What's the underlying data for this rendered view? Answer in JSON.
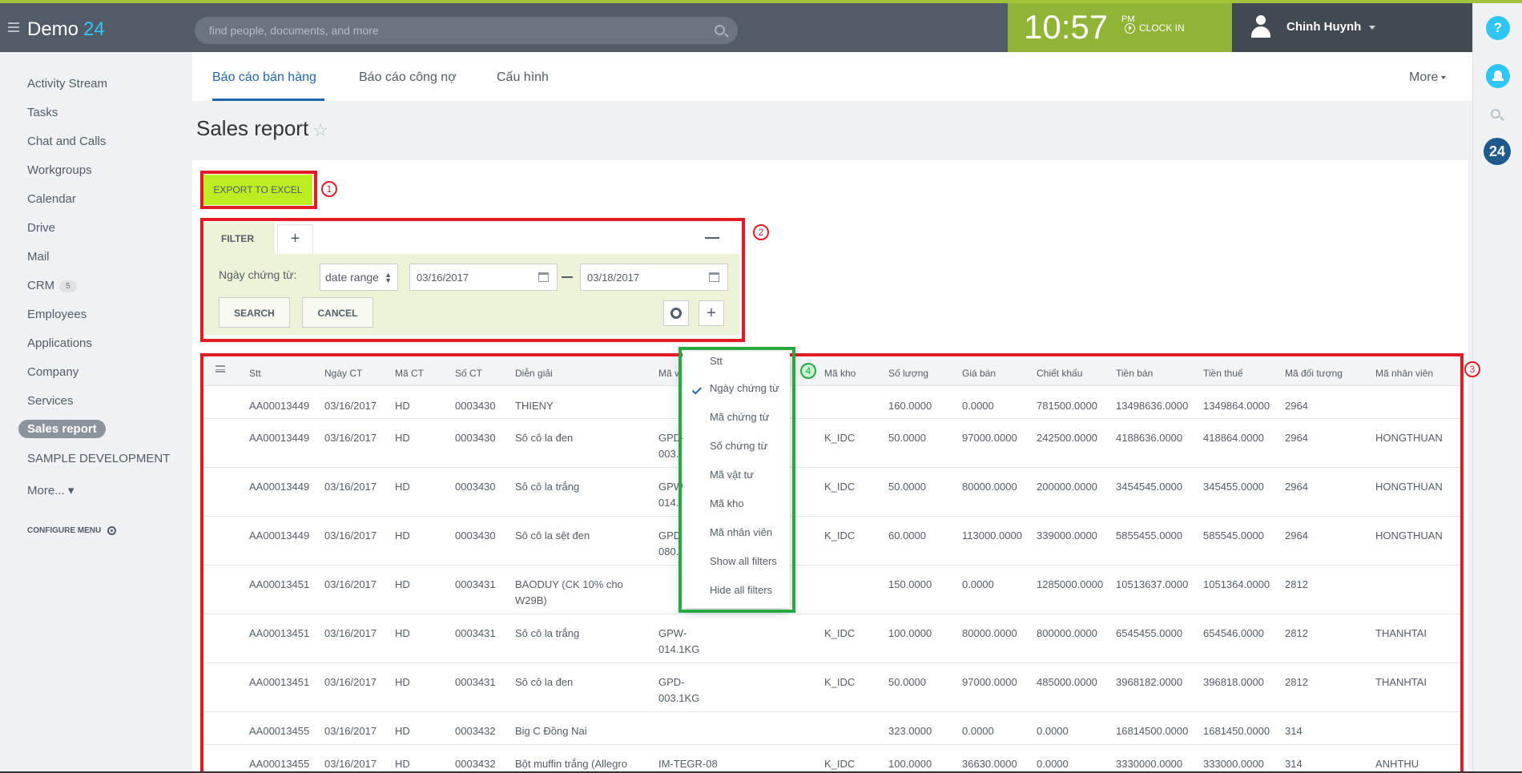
{
  "app": {
    "name": "Demo",
    "number": "24"
  },
  "search": {
    "placeholder": "find people, documents, and more"
  },
  "clock": {
    "time": "10:57",
    "ampm": "PM",
    "clockin_label": "CLOCK IN"
  },
  "user": {
    "name": "Chinh Huynh"
  },
  "rail": {
    "help": "?",
    "badge": "24"
  },
  "sidebar": {
    "items": [
      {
        "label": "Activity Stream"
      },
      {
        "label": "Tasks"
      },
      {
        "label": "Chat and Calls"
      },
      {
        "label": "Workgroups"
      },
      {
        "label": "Calendar"
      },
      {
        "label": "Drive"
      },
      {
        "label": "Mail"
      },
      {
        "label": "CRM",
        "badge": "5"
      },
      {
        "label": "Employees"
      },
      {
        "label": "Applications"
      },
      {
        "label": "Company"
      },
      {
        "label": "Services"
      },
      {
        "label": "Sales report"
      },
      {
        "label": "SAMPLE DEVELOPMENT"
      },
      {
        "label": "More... ▾"
      }
    ],
    "configure_label": "CONFIGURE MENU"
  },
  "tabs": {
    "items": [
      "Báo cáo bán hàng",
      "Báo cáo công nợ",
      "Cấu hình"
    ],
    "more": "More"
  },
  "page": {
    "title": "Sales report",
    "export_label": "EXPORT TO EXCEL"
  },
  "annotations": {
    "m1": "1",
    "m2": "2",
    "m3": "3",
    "m4": "4"
  },
  "filter": {
    "tab_label": "FILTER",
    "add_label": "+",
    "field_label": "Ngày chứng từ:",
    "range_type": "date range",
    "date_from": "03/16/2017",
    "date_to": "03/18/2017",
    "search_label": "SEARCH",
    "cancel_label": "CANCEL",
    "plus_label": "+"
  },
  "grid": {
    "columns": [
      "Stt",
      "Ngày CT",
      "Mã CT",
      "Số CT",
      "Diễn giải",
      "Mã v",
      "Mã kho",
      "Số lượng",
      "Giá bán",
      "Chiết khấu",
      "Tiền bán",
      "Tiền thuế",
      "Mã đối tượng",
      "Mã nhân viên"
    ],
    "rows": [
      [
        "AA00013449",
        "03/16/2017",
        "HD",
        "0003430",
        "THIENY",
        "",
        "",
        "160.0000",
        "0.0000",
        "781500.0000",
        "13498636.0000",
        "1349864.0000",
        "2964",
        ""
      ],
      [
        "AA00013449",
        "03/16/2017",
        "HD",
        "0003430",
        "Sô cô la đen",
        "GPD-\n003.",
        "K_IDC",
        "50.0000",
        "97000.0000",
        "242500.0000",
        "4188636.0000",
        "418864.0000",
        "2964",
        "HONGTHUAN"
      ],
      [
        "AA00013449",
        "03/16/2017",
        "HD",
        "0003430",
        "Sô cô la trắng",
        "GPW\n014.",
        "K_IDC",
        "50.0000",
        "80000.0000",
        "200000.0000",
        "3454545.0000",
        "345455.0000",
        "2964",
        "HONGTHUAN"
      ],
      [
        "AA00013449",
        "03/16/2017",
        "HD",
        "0003430",
        "Sô cô la sệt đen",
        "GPD\n080.",
        "K_IDC",
        "60.0000",
        "113000.0000",
        "339000.0000",
        "5855455.0000",
        "585545.0000",
        "2964",
        "HONGTHUAN"
      ],
      [
        "AA00013451",
        "03/16/2017",
        "HD",
        "0003431",
        "BAODUY (CK 10% cho W29B)",
        "",
        "",
        "150.0000",
        "0.0000",
        "1285000.0000",
        "10513637.0000",
        "1051364.0000",
        "2812",
        ""
      ],
      [
        "AA00013451",
        "03/16/2017",
        "HD",
        "0003431",
        "Sô cô la trắng",
        "GPW-\n014.1KG",
        "K_IDC",
        "100.0000",
        "80000.0000",
        "800000.0000",
        "6545455.0000",
        "654546.0000",
        "2812",
        "THANHTAI"
      ],
      [
        "AA00013451",
        "03/16/2017",
        "HD",
        "0003431",
        "Sô cô la đen",
        "GPD-\n003.1KG",
        "K_IDC",
        "50.0000",
        "97000.0000",
        "485000.0000",
        "3968182.0000",
        "396818.0000",
        "2812",
        "THANHTAI"
      ],
      [
        "AA00013455",
        "03/16/2017",
        "HD",
        "0003432",
        "Big C Đồng Nai",
        "",
        "",
        "323.0000",
        "0.0000",
        "0.0000",
        "16814500.0000",
        "1681450.0000",
        "314",
        ""
      ],
      [
        "AA00013455",
        "03/16/2017",
        "HD",
        "0003432",
        "Bột muffin trắng (Allegro",
        "IM-TEGR-08",
        "K_IDC",
        "100.0000",
        "36630.0000",
        "0.0000",
        "3330000.0000",
        "333000.0000",
        "314",
        "ANHTHU"
      ]
    ]
  },
  "dropdown": {
    "items": [
      "Stt",
      "Ngày chứng từ",
      "Mã chứng từ",
      "Số chứng từ",
      "Mã vật tư",
      "Mã kho",
      "Mã nhân viên",
      "Show all filters",
      "Hide all filters"
    ],
    "checked": "Ngày chứng từ"
  },
  "colors": {
    "accent": "#a2c43d",
    "topbar": "#525c69",
    "link": "#2067b0",
    "export": "#bbed21",
    "annotation_red": "#e31b23",
    "annotation_green": "#27a843"
  }
}
